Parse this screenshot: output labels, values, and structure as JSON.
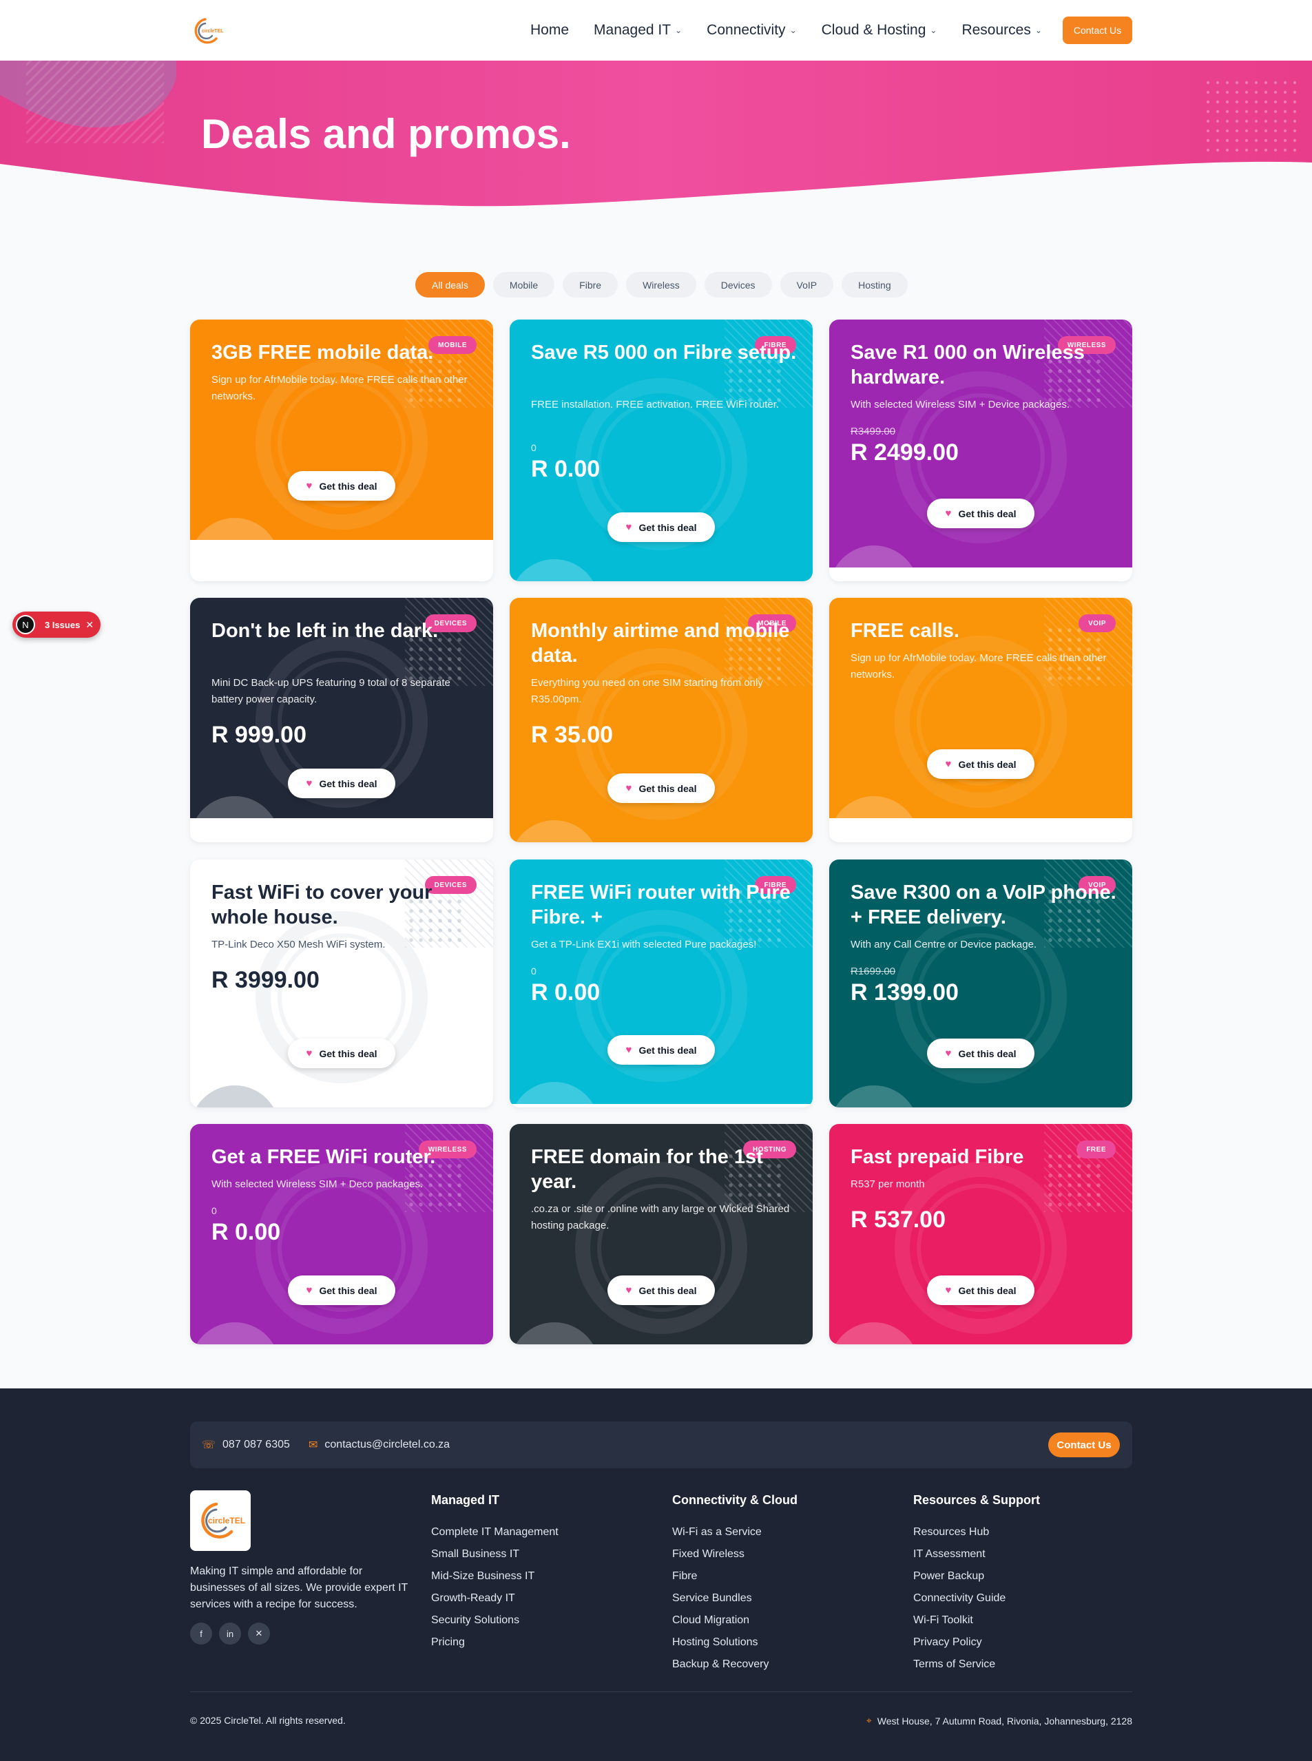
{
  "header": {
    "logo_text": "circleTEL",
    "nav": [
      {
        "label": "Home",
        "has_dropdown": false
      },
      {
        "label": "Managed IT",
        "has_dropdown": true
      },
      {
        "label": "Connectivity",
        "has_dropdown": true
      },
      {
        "label": "Cloud & Hosting",
        "has_dropdown": true
      },
      {
        "label": "Resources",
        "has_dropdown": true
      }
    ],
    "contact_label": "Contact Us"
  },
  "hero": {
    "title": "Deals and promos."
  },
  "filters": [
    "All deals",
    "Mobile",
    "Fibre",
    "Wireless",
    "Devices",
    "VoIP",
    "Hosting"
  ],
  "active_filter": "All deals",
  "deal_button_label": "Get this deal",
  "cards": [
    {
      "badge": "MOBILE",
      "title": "3GB FREE mobile data.",
      "desc": "Sign up for AfrMobile today. More FREE calls than other networks.",
      "small": "",
      "old_price": "",
      "price": "",
      "color": "#fa8c08"
    },
    {
      "badge": "FIBRE",
      "title": "Save R5 000 on Fibre setup.",
      "desc": "FREE installation. FREE activation. FREE WiFi router.",
      "small": "0",
      "old_price": "",
      "price": "R 0.00",
      "color": "#05bcd6"
    },
    {
      "badge": "WIRELESS",
      "title": "Save R1 000 on Wireless hardware.",
      "desc": "With selected Wireless SIM + Device packages.",
      "small": "",
      "old_price": "R3499.00",
      "price": "R 2499.00",
      "color": "#9d27b1"
    },
    {
      "badge": "DEVICES",
      "title": "Don't be left in the dark.",
      "desc": "Mini DC Back-up UPS featuring 9 total of 8 separate battery power capacity.",
      "small": "",
      "old_price": "",
      "price": "R 999.00",
      "color": "#212838"
    },
    {
      "badge": "MOBILE",
      "title": "Monthly airtime and mobile data.",
      "desc": "Everything you need on one SIM starting from only R35.00pm.",
      "small": "",
      "old_price": "",
      "price": "R 35.00",
      "color": "#fa9408"
    },
    {
      "badge": "VOIP",
      "title": "FREE calls.",
      "desc": "Sign up for AfrMobile today. More FREE calls than other networks.",
      "small": "",
      "old_price": "",
      "price": "",
      "color": "#fa9408"
    },
    {
      "badge": "DEVICES",
      "title": "Fast WiFi to cover your whole house.",
      "desc": "TP-Link Deco X50 Mesh WiFi system.",
      "small": "",
      "old_price": "",
      "price": "R 3999.00",
      "color": "#ffffff",
      "light": true
    },
    {
      "badge": "FIBRE",
      "title": "FREE WiFi router with Pure Fibre. +",
      "desc": "Get a TP-Link EX1i with selected Pure packages!",
      "small": "0",
      "old_price": "",
      "price": "R 0.00",
      "color": "#05bcd6"
    },
    {
      "badge": "VOIP",
      "title": "Save R300 on a VoIP phone. + FREE delivery.",
      "desc": "With any Call Centre or Device package.",
      "small": "",
      "old_price": "R1699.00",
      "price": "R 1399.00",
      "color": "#015f63"
    },
    {
      "badge": "WIRELESS",
      "title": "Get a FREE WiFi router.",
      "desc": "With selected Wireless SIM + Deco packages.",
      "small": "0",
      "old_price": "",
      "price": "R 0.00",
      "color": "#9d27b1"
    },
    {
      "badge": "HOSTING",
      "title": "FREE domain for the 1st year.",
      "desc": ".co.za or .site or .online with any large or Wicked Shared hosting package.",
      "small": "",
      "old_price": "",
      "price": "",
      "color": "#262e36"
    },
    {
      "badge": "FREE",
      "title": "Fast prepaid Fibre",
      "desc": "R537 per month",
      "small": "",
      "old_price": "",
      "price": "R 537.00",
      "color": "#ea1e63"
    }
  ],
  "issues_badge": {
    "label": "3 Issues",
    "initial": "N"
  },
  "footer": {
    "phone": "087 087 6305",
    "email": "contactus@circletel.co.za",
    "contact_label": "Contact Us",
    "about": "Making IT simple and affordable for businesses of all sizes. We provide expert IT services with a recipe for success.",
    "columns": [
      {
        "title": "Managed IT",
        "links": [
          "Complete IT Management",
          "Small Business IT",
          "Mid-Size Business IT",
          "Growth-Ready IT",
          "Security Solutions",
          "Pricing"
        ]
      },
      {
        "title": "Connectivity & Cloud",
        "links": [
          "Wi-Fi as a Service",
          "Fixed Wireless",
          "Fibre",
          "Service Bundles",
          "Cloud Migration",
          "Hosting Solutions",
          "Backup & Recovery"
        ]
      },
      {
        "title": "Resources & Support",
        "links": [
          "Resources Hub",
          "IT Assessment",
          "Power Backup",
          "Connectivity Guide",
          "Wi-Fi Toolkit",
          "Privacy Policy",
          "Terms of Service"
        ]
      }
    ],
    "copyright": "© 2025 CircleTel. All rights reserved.",
    "address": "West House, 7 Autumn Road, Rivonia, Johannesburg, 2128"
  }
}
